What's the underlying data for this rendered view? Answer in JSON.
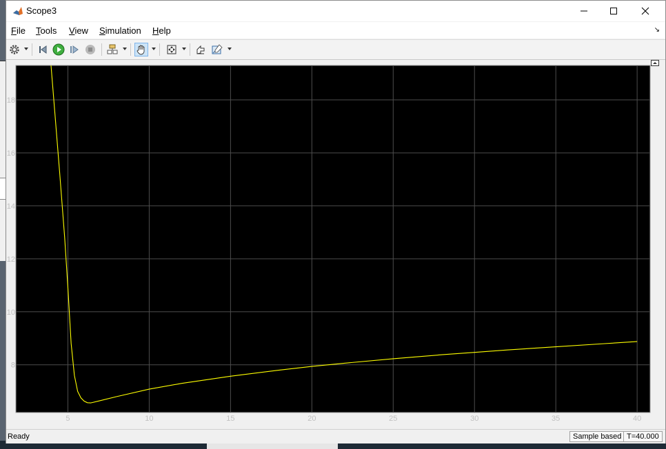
{
  "window": {
    "title": "Scope3"
  },
  "menu": [
    "File",
    "Tools",
    "View",
    "Simulation",
    "Help"
  ],
  "menu_mnemonic": [
    "F",
    "T",
    "V",
    "S",
    "H"
  ],
  "toolbar": {
    "buttons": [
      "settings-icon",
      "step-back-icon",
      "run-icon",
      "step-forward-icon",
      "stop-icon",
      "highlight-block-icon",
      "pan-hand-icon",
      "zoom-fit-icon",
      "restore-view-icon",
      "cursor-measure-icon"
    ]
  },
  "status": {
    "ready": "Ready",
    "mode": "Sample based",
    "time": "T=40.000"
  },
  "colors": {
    "plot_bg": "#000000",
    "grid": "#4d4d4d",
    "trace": "#ffff00",
    "tick": "#c0c0c0"
  },
  "chart_data": {
    "type": "line",
    "title": "",
    "xlabel": "",
    "ylabel": "",
    "xlim": [
      1.8,
      40.8
    ],
    "ylim": [
      6.2,
      19.3
    ],
    "xticks": [
      5,
      10,
      15,
      20,
      25,
      30,
      35,
      40
    ],
    "yticks": [
      8,
      10,
      12,
      14,
      16,
      18
    ],
    "grid": true,
    "series": [
      {
        "x": [
          3.96,
          4.2,
          4.5,
          4.8,
          5.0,
          5.2,
          5.4,
          5.6,
          5.8,
          6.0,
          6.2,
          6.4,
          7,
          8,
          10,
          12,
          15,
          18,
          20,
          22,
          25,
          28,
          30,
          32,
          35,
          38,
          40
        ],
        "y": [
          19.3,
          17.5,
          15.2,
          12.8,
          10.9,
          8.8,
          7.6,
          7.0,
          6.75,
          6.63,
          6.57,
          6.56,
          6.65,
          6.8,
          7.08,
          7.3,
          7.57,
          7.8,
          7.94,
          8.06,
          8.23,
          8.38,
          8.47,
          8.56,
          8.68,
          8.8,
          8.88
        ]
      }
    ]
  }
}
